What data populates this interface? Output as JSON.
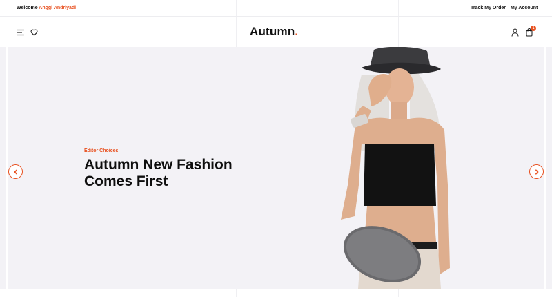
{
  "topbar": {
    "welcome_prefix": "Welcome",
    "user_name": "Anggi Andriyadi",
    "track_order": "Track My Order",
    "my_account": "My Account"
  },
  "header": {
    "logo": "Autumn",
    "logo_dot": ".",
    "cart_count": "1"
  },
  "hero": {
    "eyebrow": "Editor Choices",
    "headline_line1": "Autumn New Fashion",
    "headline_line2": "Comes First"
  },
  "icons": {
    "menu": "menu-icon",
    "wishlist": "heart-icon",
    "account": "user-icon",
    "cart": "shopping-bag-icon",
    "prev": "chevron-left-icon",
    "next": "chevron-right-icon"
  },
  "colors": {
    "accent": "#e8501f",
    "hero_bg": "#f3f2f6",
    "text": "#111111"
  }
}
